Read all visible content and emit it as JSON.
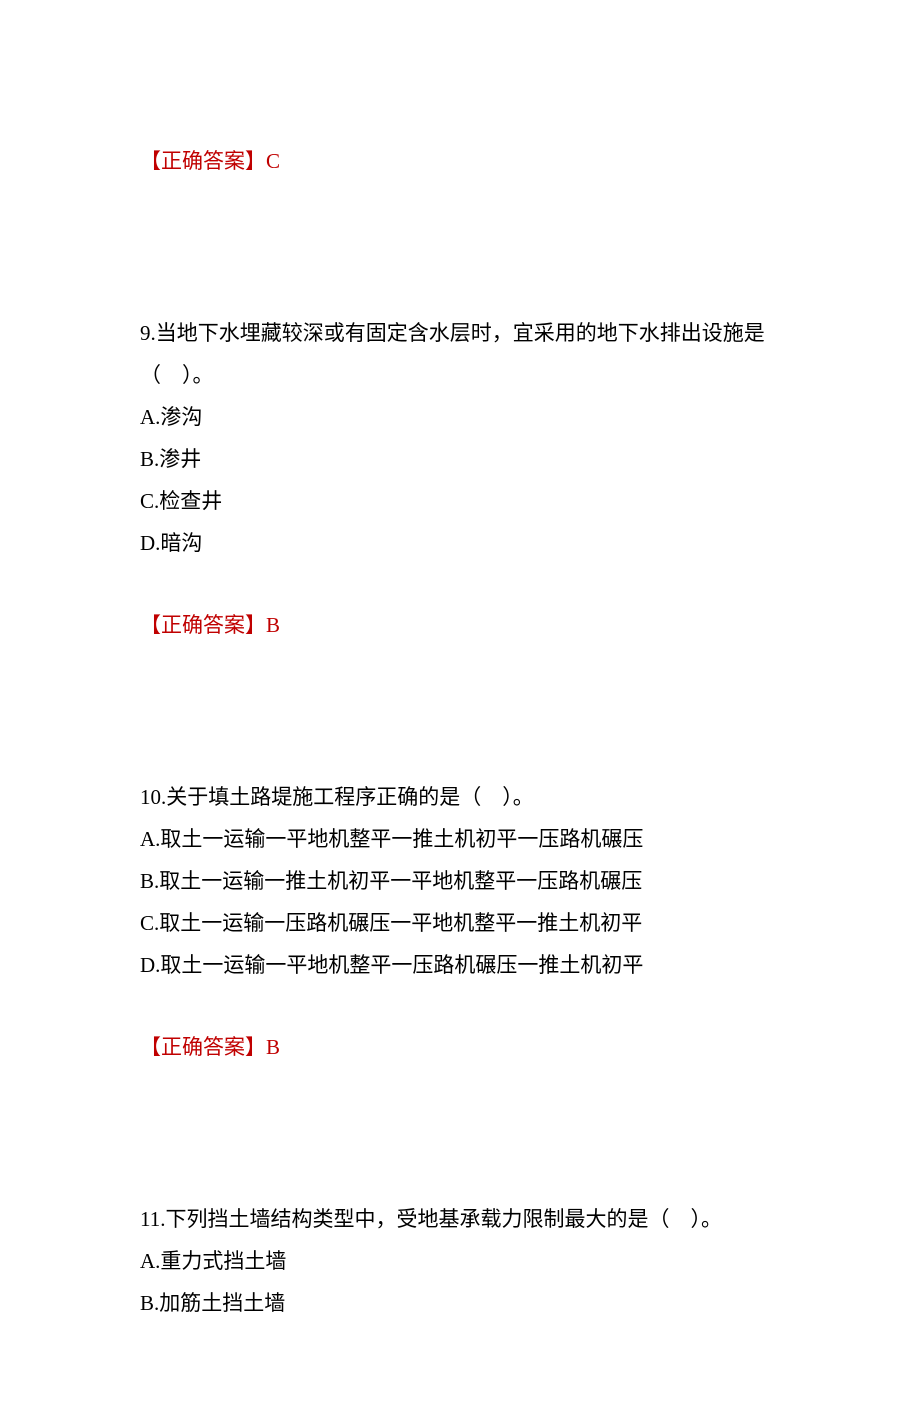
{
  "answer_label_open": "【",
  "answer_label_text": "正确答案",
  "answer_label_close": "】",
  "top_answer": {
    "value": "C"
  },
  "questions": [
    {
      "number": "9.",
      "stem": "当地下水埋藏较深或有固定含水层时，宜采用的地下水排出设施是（　）。",
      "options": [
        {
          "label": "A.",
          "text": "渗沟"
        },
        {
          "label": "B.",
          "text": "渗井"
        },
        {
          "label": "C.",
          "text": "检查井"
        },
        {
          "label": "D.",
          "text": "暗沟"
        }
      ],
      "answer": "B"
    },
    {
      "number": "10.",
      "stem": "关于填土路堤施工程序正确的是（　）。",
      "options": [
        {
          "label": "A.",
          "text": "取土一运输一平地机整平一推土机初平一压路机碾压"
        },
        {
          "label": "B.",
          "text": "取土一运输一推土机初平一平地机整平一压路机碾压"
        },
        {
          "label": "C.",
          "text": "取土一运输一压路机碾压一平地机整平一推土机初平"
        },
        {
          "label": "D.",
          "text": "取土一运输一平地机整平一压路机碾压一推土机初平"
        }
      ],
      "answer": "B"
    },
    {
      "number": "11.",
      "stem": "下列挡土墙结构类型中，受地基承载力限制最大的是（　）。",
      "options": [
        {
          "label": "A.",
          "text": "重力式挡土墙"
        },
        {
          "label": "B.",
          "text": "加筋土挡土墙"
        }
      ],
      "answer": null
    }
  ]
}
